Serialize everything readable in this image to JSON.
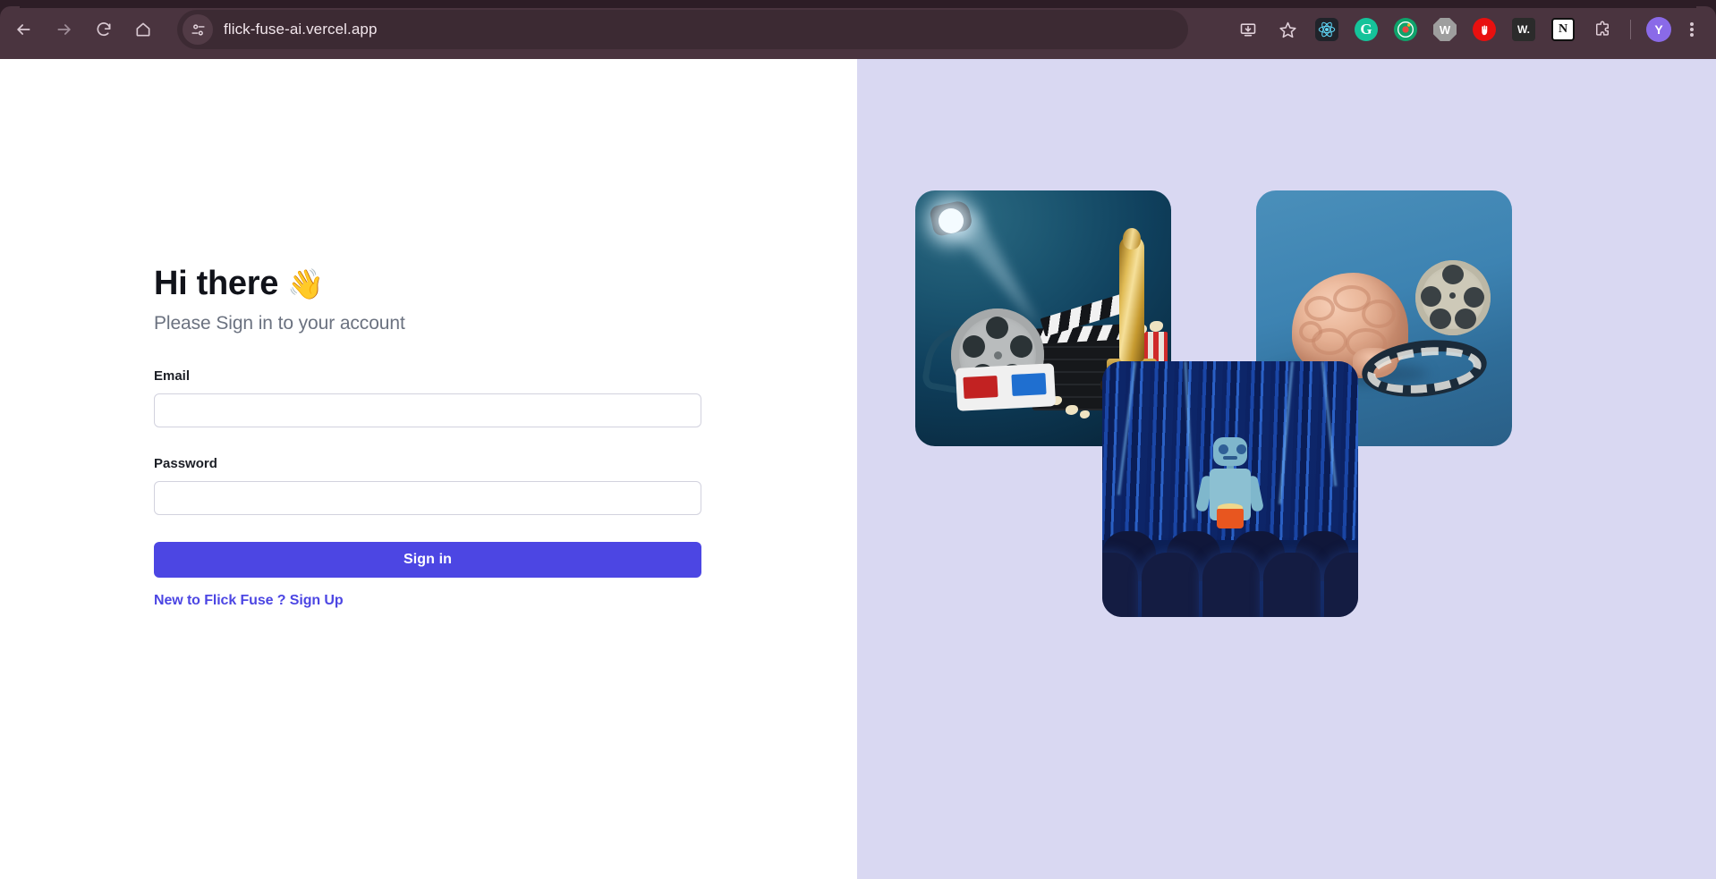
{
  "browser": {
    "url": "flick-fuse-ai.vercel.app",
    "nav": {
      "back_label": "Back",
      "forward_label": "Forward",
      "reload_label": "Reload",
      "home_label": "Home"
    },
    "site_settings_icon": "tune-sliders-icon",
    "toolbar_right": [
      {
        "name": "install-app-icon",
        "label": "Install page as app"
      },
      {
        "name": "bookmark-star-icon",
        "label": "Bookmark this tab"
      },
      {
        "name": "react-devtools-extension-icon",
        "label": "React Developer Tools",
        "glyph": "",
        "color": "#61dafb"
      },
      {
        "name": "grammarly-extension-icon",
        "label": "Grammarly",
        "glyph": "G",
        "color": "#15c39a"
      },
      {
        "name": "target-extension-icon",
        "label": "Extension",
        "glyph": "",
        "color": "#0fa36b"
      },
      {
        "name": "wappalyzer-extension-icon",
        "label": "W",
        "glyph": "W",
        "color": "#9e9e9e"
      },
      {
        "name": "ublock-origin-extension-icon",
        "label": "uBlock Origin",
        "glyph": "✋",
        "color": "#e8100f"
      },
      {
        "name": "wikiwand-extension-icon",
        "label": "W.",
        "glyph": "W.",
        "color": "#2b2b2b"
      },
      {
        "name": "notion-web-clipper-extension-icon",
        "label": "Notion Web Clipper",
        "glyph": "N",
        "color": "#ffffff"
      },
      {
        "name": "extensions-puzzle-icon",
        "label": "Extensions"
      }
    ],
    "profile_initial": "Y",
    "menu_label": "Customize and control Google Chrome",
    "colors": {
      "toolbar": "#4a343f",
      "tabstrip": "#2d1d26",
      "omnibox": "#3c2a33",
      "avatar": "#8a6ae8"
    }
  },
  "page": {
    "colors": {
      "left_background": "#ffffff",
      "right_background": "#d9d8f2",
      "accent": "#4c46e3",
      "input_border": "#d2d2de",
      "subtitle_text": "#6b7280"
    },
    "signin": {
      "heading": "Hi there",
      "wave_emoji": "👋",
      "subtitle": "Please Sign in to your account",
      "email_label": "Email",
      "email_value": "",
      "email_placeholder": "",
      "password_label": "Password",
      "password_value": "",
      "password_placeholder": "",
      "submit_label": "Sign in",
      "signup_prompt": "New to Flick Fuse ? Sign Up"
    },
    "collage": {
      "cards": [
        {
          "name": "cinema-awards-image",
          "alt": "Spotlight shining on a film reel, clapperboard, Oscar statuette, popcorn and 3D glasses on a dark blue background"
        },
        {
          "name": "brain-film-reel-image",
          "alt": "Anatomical brain model beside a film reel and looped filmstrip on a blue background"
        },
        {
          "name": "robot-cinema-image",
          "alt": "Blue robot holding a bucket of popcorn seated in a dark cinema auditorium"
        }
      ]
    }
  }
}
